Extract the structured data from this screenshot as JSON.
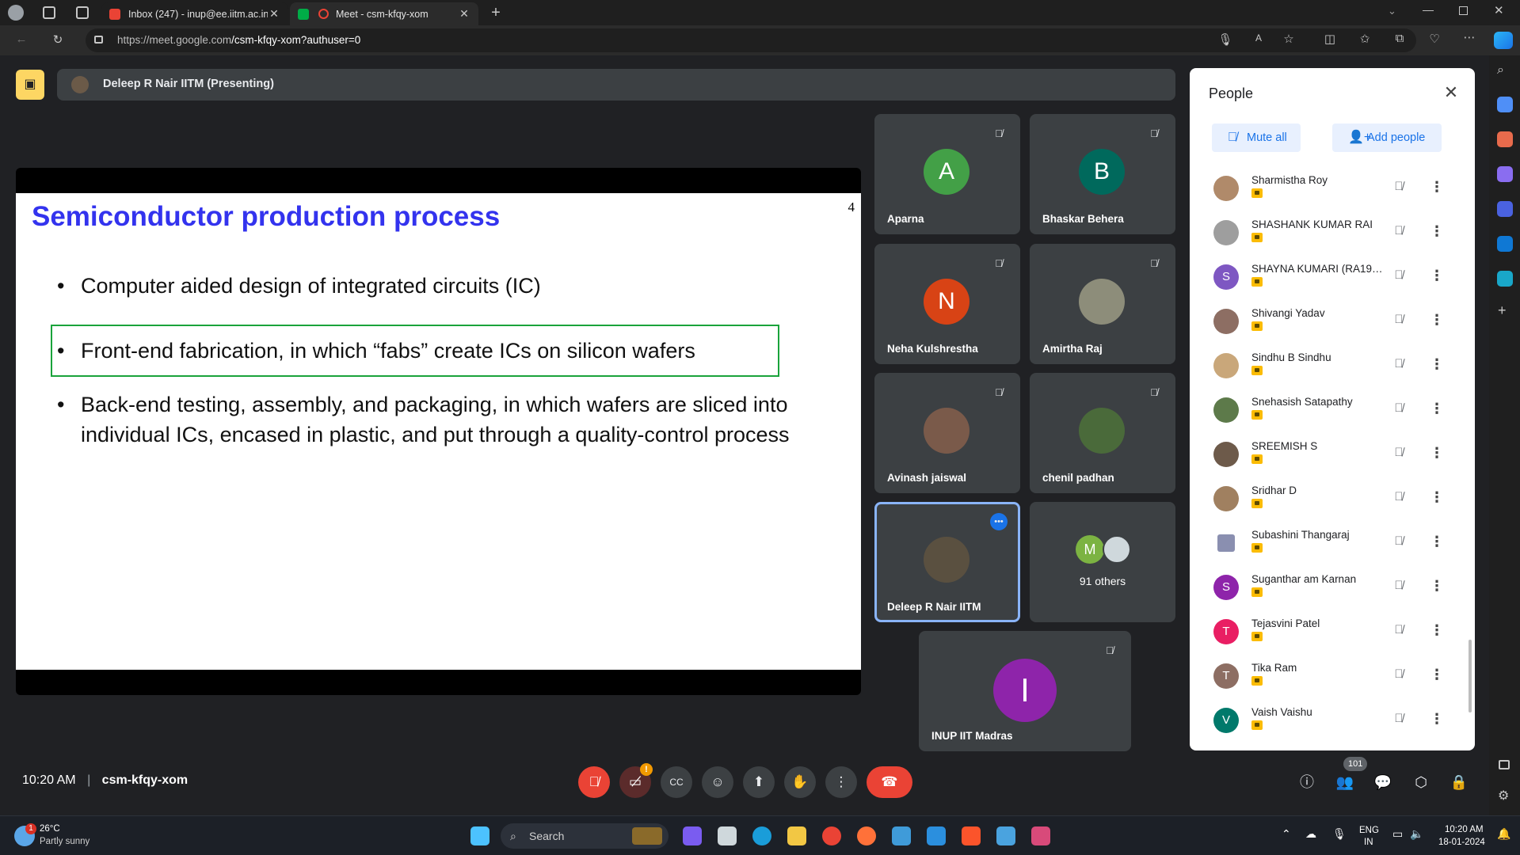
{
  "browser": {
    "tabs": [
      {
        "title": "Inbox (247) - inup@ee.iitm.ac.in",
        "favicon": "gmail-icon"
      },
      {
        "title": "Meet - csm-kfqy-xom",
        "favicon": "meet-icon"
      }
    ],
    "url_host": "https://meet.google.com",
    "url_path": "/csm-kfqy-xom?authuser=0"
  },
  "meet": {
    "presenter_label": "Deleep R Nair IITM (Presenting)",
    "meeting_time": "10:20 AM",
    "meeting_code": "csm-kfqy-xom",
    "participant_count_badge": "101",
    "camera_warning_badge": "!"
  },
  "slide": {
    "title": "Semiconductor production process",
    "page_number": "4",
    "bullets": [
      "Computer aided design of integrated circuits (IC)",
      "Front-end fabrication, in which “fabs” create ICs on silicon wafers",
      "Back-end testing, assembly, and packaging, in which wafers are sliced into individual ICs, encased in plastic, and put through a quality-control process"
    ],
    "bullet_glyph": "•"
  },
  "tiles": [
    {
      "name": "Aparna",
      "initial": "A",
      "color": "#43a047"
    },
    {
      "name": "Bhaskar Behera",
      "initial": "B",
      "color": "#00695c"
    },
    {
      "name": "Neha Kulshrestha",
      "initial": "N",
      "color": "#d84315"
    },
    {
      "name": "Amirtha Raj",
      "initial": "",
      "color": "#8d8d7a"
    },
    {
      "name": "Avinash jaiswal",
      "initial": "",
      "color": "#7a5a4a"
    },
    {
      "name": "chenil padhan",
      "initial": "",
      "color": "#4a6a3a"
    },
    {
      "name": "Deleep R Nair IITM",
      "initial": "",
      "color": "#5a5040"
    },
    {
      "name": "INUP IIT Madras",
      "initial": "I",
      "color": "#8e24aa"
    }
  ],
  "others": {
    "label": "91 others",
    "initial": "M",
    "color": "#7cb342"
  },
  "people_panel": {
    "title": "People",
    "mute_all_label": "Mute all",
    "add_people_label": "Add people",
    "people": [
      {
        "name": "Sharmistha Roy",
        "initial": "",
        "color": "#b08a6a"
      },
      {
        "name": "SHASHANK KUMAR RAI",
        "initial": "",
        "color": "#9e9e9e"
      },
      {
        "name": "SHAYNA KUMARI (RA191...",
        "initial": "S",
        "color": "#7e57c2"
      },
      {
        "name": "Shivangi Yadav",
        "initial": "",
        "color": "#8d6e63"
      },
      {
        "name": "Sindhu B Sindhu",
        "initial": "",
        "color": "#c9a77a"
      },
      {
        "name": "Snehasish Satapathy",
        "initial": "",
        "color": "#5d7a4a"
      },
      {
        "name": "SREEMISH S",
        "initial": "",
        "color": "#6d5a4a"
      },
      {
        "name": "Sridhar D",
        "initial": "",
        "color": "#a08060"
      },
      {
        "name": "Subashini Thangaraj",
        "initial": "",
        "color": "#8a8fb0"
      },
      {
        "name": "Suganthar am Karnan",
        "initial": "S",
        "color": "#8e24aa"
      },
      {
        "name": "Tejasvini Patel",
        "initial": "T",
        "color": "#e91e63"
      },
      {
        "name": "Tika Ram",
        "initial": "T",
        "color": "#8d6e63"
      },
      {
        "name": "Vaish Vaishu",
        "initial": "V",
        "color": "#00796b"
      }
    ]
  },
  "taskbar": {
    "weather_temp": "26°C",
    "weather_desc": "Partly sunny",
    "weather_badge": "1",
    "search_label": "Search",
    "lang_top": "ENG",
    "lang_bottom": "IN",
    "time": "10:20 AM",
    "date": "18-01-2024"
  }
}
